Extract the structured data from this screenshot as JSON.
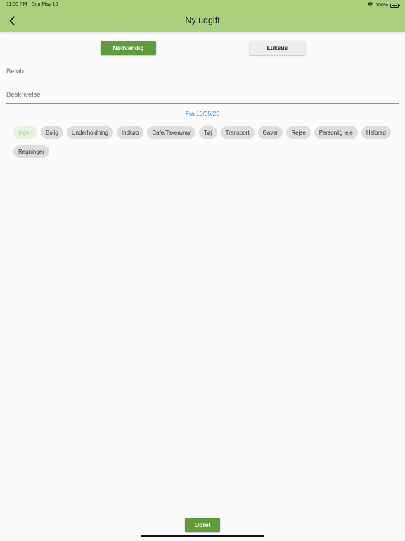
{
  "status_bar": {
    "time": "11:30 PM",
    "date": "Sun May 10",
    "battery": "100%",
    "battery_level": 1.0
  },
  "header": {
    "title": "Ny udgift",
    "back_icon": "chevron-left-icon",
    "background_color": "#a8d17e"
  },
  "type_toggle": {
    "necessary_label": "Nødvendig",
    "luxury_label": "Luksus",
    "selected": "necessary"
  },
  "form": {
    "amount_placeholder": "Beløb",
    "amount_value": "",
    "description_placeholder": "Beskrivelse",
    "description_value": "",
    "date_label": "Fra 10/05/20"
  },
  "categories": [
    {
      "label": "Ingen",
      "selected": true
    },
    {
      "label": "Bolig",
      "selected": false
    },
    {
      "label": "Underholdning",
      "selected": false
    },
    {
      "label": "Indkøb",
      "selected": false
    },
    {
      "label": "Cafe/Takeaway",
      "selected": false
    },
    {
      "label": "Tøj",
      "selected": false
    },
    {
      "label": "Transport",
      "selected": false
    },
    {
      "label": "Gaver",
      "selected": false
    },
    {
      "label": "Rejse",
      "selected": false
    },
    {
      "label": "Personlig leje",
      "selected": false
    },
    {
      "label": "Helbred",
      "selected": false
    },
    {
      "label": "Regninger",
      "selected": false
    }
  ],
  "submit_label": "Opret",
  "colors": {
    "accent_green": "#5f9b3a",
    "header_green": "#a8d17e",
    "link_blue": "#2f8fd8"
  }
}
